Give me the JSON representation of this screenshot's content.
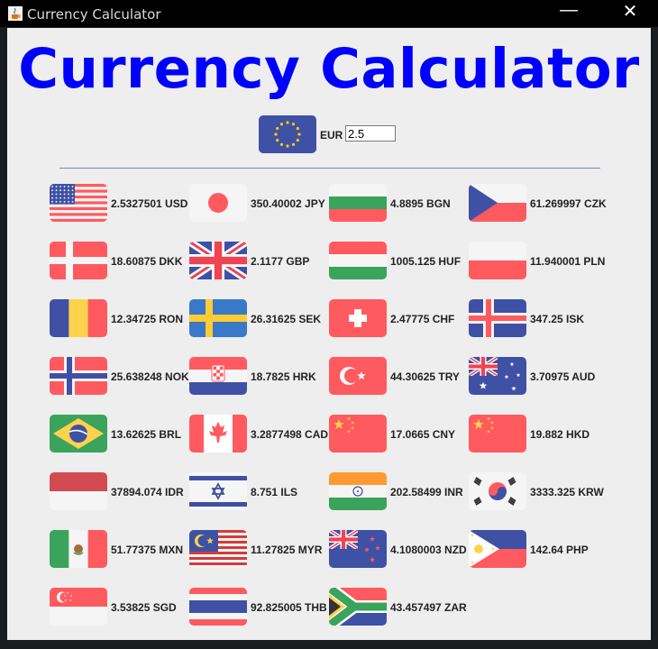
{
  "window": {
    "title": "Currency Calculator",
    "minimize_glyph": "—",
    "close_glyph": "✕"
  },
  "app": {
    "heading": "Currency Calculator",
    "base_currency": {
      "code": "EUR",
      "amount": "2.5",
      "flag": "eu-flag-icon"
    }
  },
  "colors": {
    "heading": "#0000ff",
    "background": "#eeeeee",
    "separator": "#7a8aa6"
  },
  "rates": [
    {
      "flag": "us-flag-icon",
      "value": "2.5327501",
      "code": "USD",
      "text": "2.5327501 USD"
    },
    {
      "flag": "jp-flag-icon",
      "value": "350.40002",
      "code": "JPY",
      "text": "350.40002 JPY"
    },
    {
      "flag": "bg-flag-icon",
      "value": "4.8895",
      "code": "BGN",
      "text": "4.8895 BGN"
    },
    {
      "flag": "cz-flag-icon",
      "value": "61.269997",
      "code": "CZK",
      "text": "61.269997 CZK"
    },
    {
      "flag": "dk-flag-icon",
      "value": "18.60875",
      "code": "DKK",
      "text": "18.60875 DKK"
    },
    {
      "flag": "gb-flag-icon",
      "value": "2.1177",
      "code": "GBP",
      "text": "2.1177 GBP"
    },
    {
      "flag": "hu-flag-icon",
      "value": "1005.125",
      "code": "HUF",
      "text": "1005.125 HUF"
    },
    {
      "flag": "pl-flag-icon",
      "value": "11.940001",
      "code": "PLN",
      "text": "11.940001 PLN"
    },
    {
      "flag": "ro-flag-icon",
      "value": "12.34725",
      "code": "RON",
      "text": "12.34725 RON"
    },
    {
      "flag": "se-flag-icon",
      "value": "26.31625",
      "code": "SEK",
      "text": "26.31625 SEK"
    },
    {
      "flag": "ch-flag-icon",
      "value": "2.47775",
      "code": "CHF",
      "text": "2.47775 CHF"
    },
    {
      "flag": "is-flag-icon",
      "value": "347.25",
      "code": "ISK",
      "text": "347.25 ISK"
    },
    {
      "flag": "no-flag-icon",
      "value": "25.638248",
      "code": "NOK",
      "text": "25.638248 NOK"
    },
    {
      "flag": "hr-flag-icon",
      "value": "18.7825",
      "code": "HRK",
      "text": "18.7825 HRK"
    },
    {
      "flag": "tr-flag-icon",
      "value": "44.30625",
      "code": "TRY",
      "text": "44.30625 TRY"
    },
    {
      "flag": "au-flag-icon",
      "value": "3.70975",
      "code": "AUD",
      "text": "3.70975 AUD"
    },
    {
      "flag": "br-flag-icon",
      "value": "13.62625",
      "code": "BRL",
      "text": "13.62625 BRL"
    },
    {
      "flag": "ca-flag-icon",
      "value": "3.2877498",
      "code": "CAD",
      "text": "3.2877498 CAD"
    },
    {
      "flag": "cn-flag-icon",
      "value": "17.0665",
      "code": "CNY",
      "text": "17.0665 CNY"
    },
    {
      "flag": "hk-flag-icon",
      "value": "19.882",
      "code": "HKD",
      "text": "19.882 HKD"
    },
    {
      "flag": "id-flag-icon",
      "value": "37894.074",
      "code": "IDR",
      "text": "37894.074 IDR"
    },
    {
      "flag": "il-flag-icon",
      "value": "8.751",
      "code": "ILS",
      "text": "8.751 ILS"
    },
    {
      "flag": "in-flag-icon",
      "value": "202.58499",
      "code": "INR",
      "text": "202.58499 INR"
    },
    {
      "flag": "kr-flag-icon",
      "value": "3333.325",
      "code": "KRW",
      "text": "3333.325 KRW"
    },
    {
      "flag": "mx-flag-icon",
      "value": "51.77375",
      "code": "MXN",
      "text": "51.77375 MXN"
    },
    {
      "flag": "my-flag-icon",
      "value": "11.27825",
      "code": "MYR",
      "text": "11.27825 MYR"
    },
    {
      "flag": "nz-flag-icon",
      "value": "4.1080003",
      "code": "NZD",
      "text": "4.1080003 NZD"
    },
    {
      "flag": "ph-flag-icon",
      "value": "142.64",
      "code": "PHP",
      "text": "142.64 PHP"
    },
    {
      "flag": "sg-flag-icon",
      "value": "3.53825",
      "code": "SGD",
      "text": "3.53825 SGD"
    },
    {
      "flag": "th-flag-icon",
      "value": "92.825005",
      "code": "THB",
      "text": "92.825005 THB"
    },
    {
      "flag": "za-flag-icon",
      "value": "43.457497",
      "code": "ZAR",
      "text": "43.457497 ZAR"
    }
  ]
}
